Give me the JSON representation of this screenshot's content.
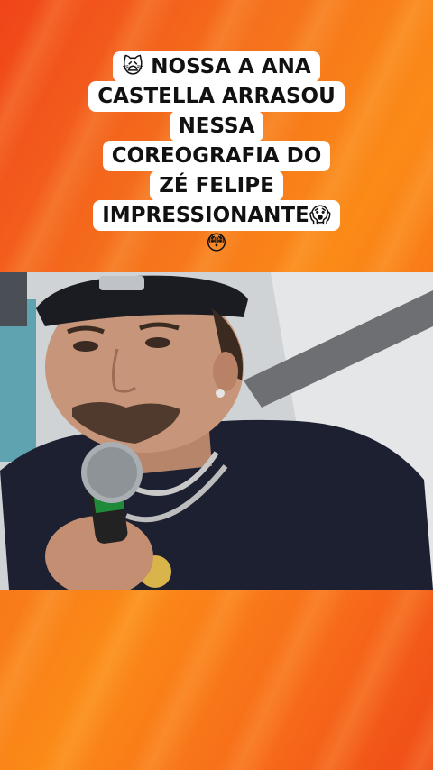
{
  "caption": {
    "lines": [
      "🙀 NOSSA A ANA",
      "CASTELLA ARRASOU",
      "NESSA",
      "COREOGRAFIA DO",
      "ZÉ FELIPE",
      "IMPRESSIONANTE😱",
      "😳"
    ]
  },
  "video": {
    "subject": "man-singing-with-microphone"
  },
  "colors": {
    "background_orange": "#f5701d",
    "background_red": "#ef4a16",
    "caption_bg": "#ffffff",
    "caption_text": "#111111"
  }
}
